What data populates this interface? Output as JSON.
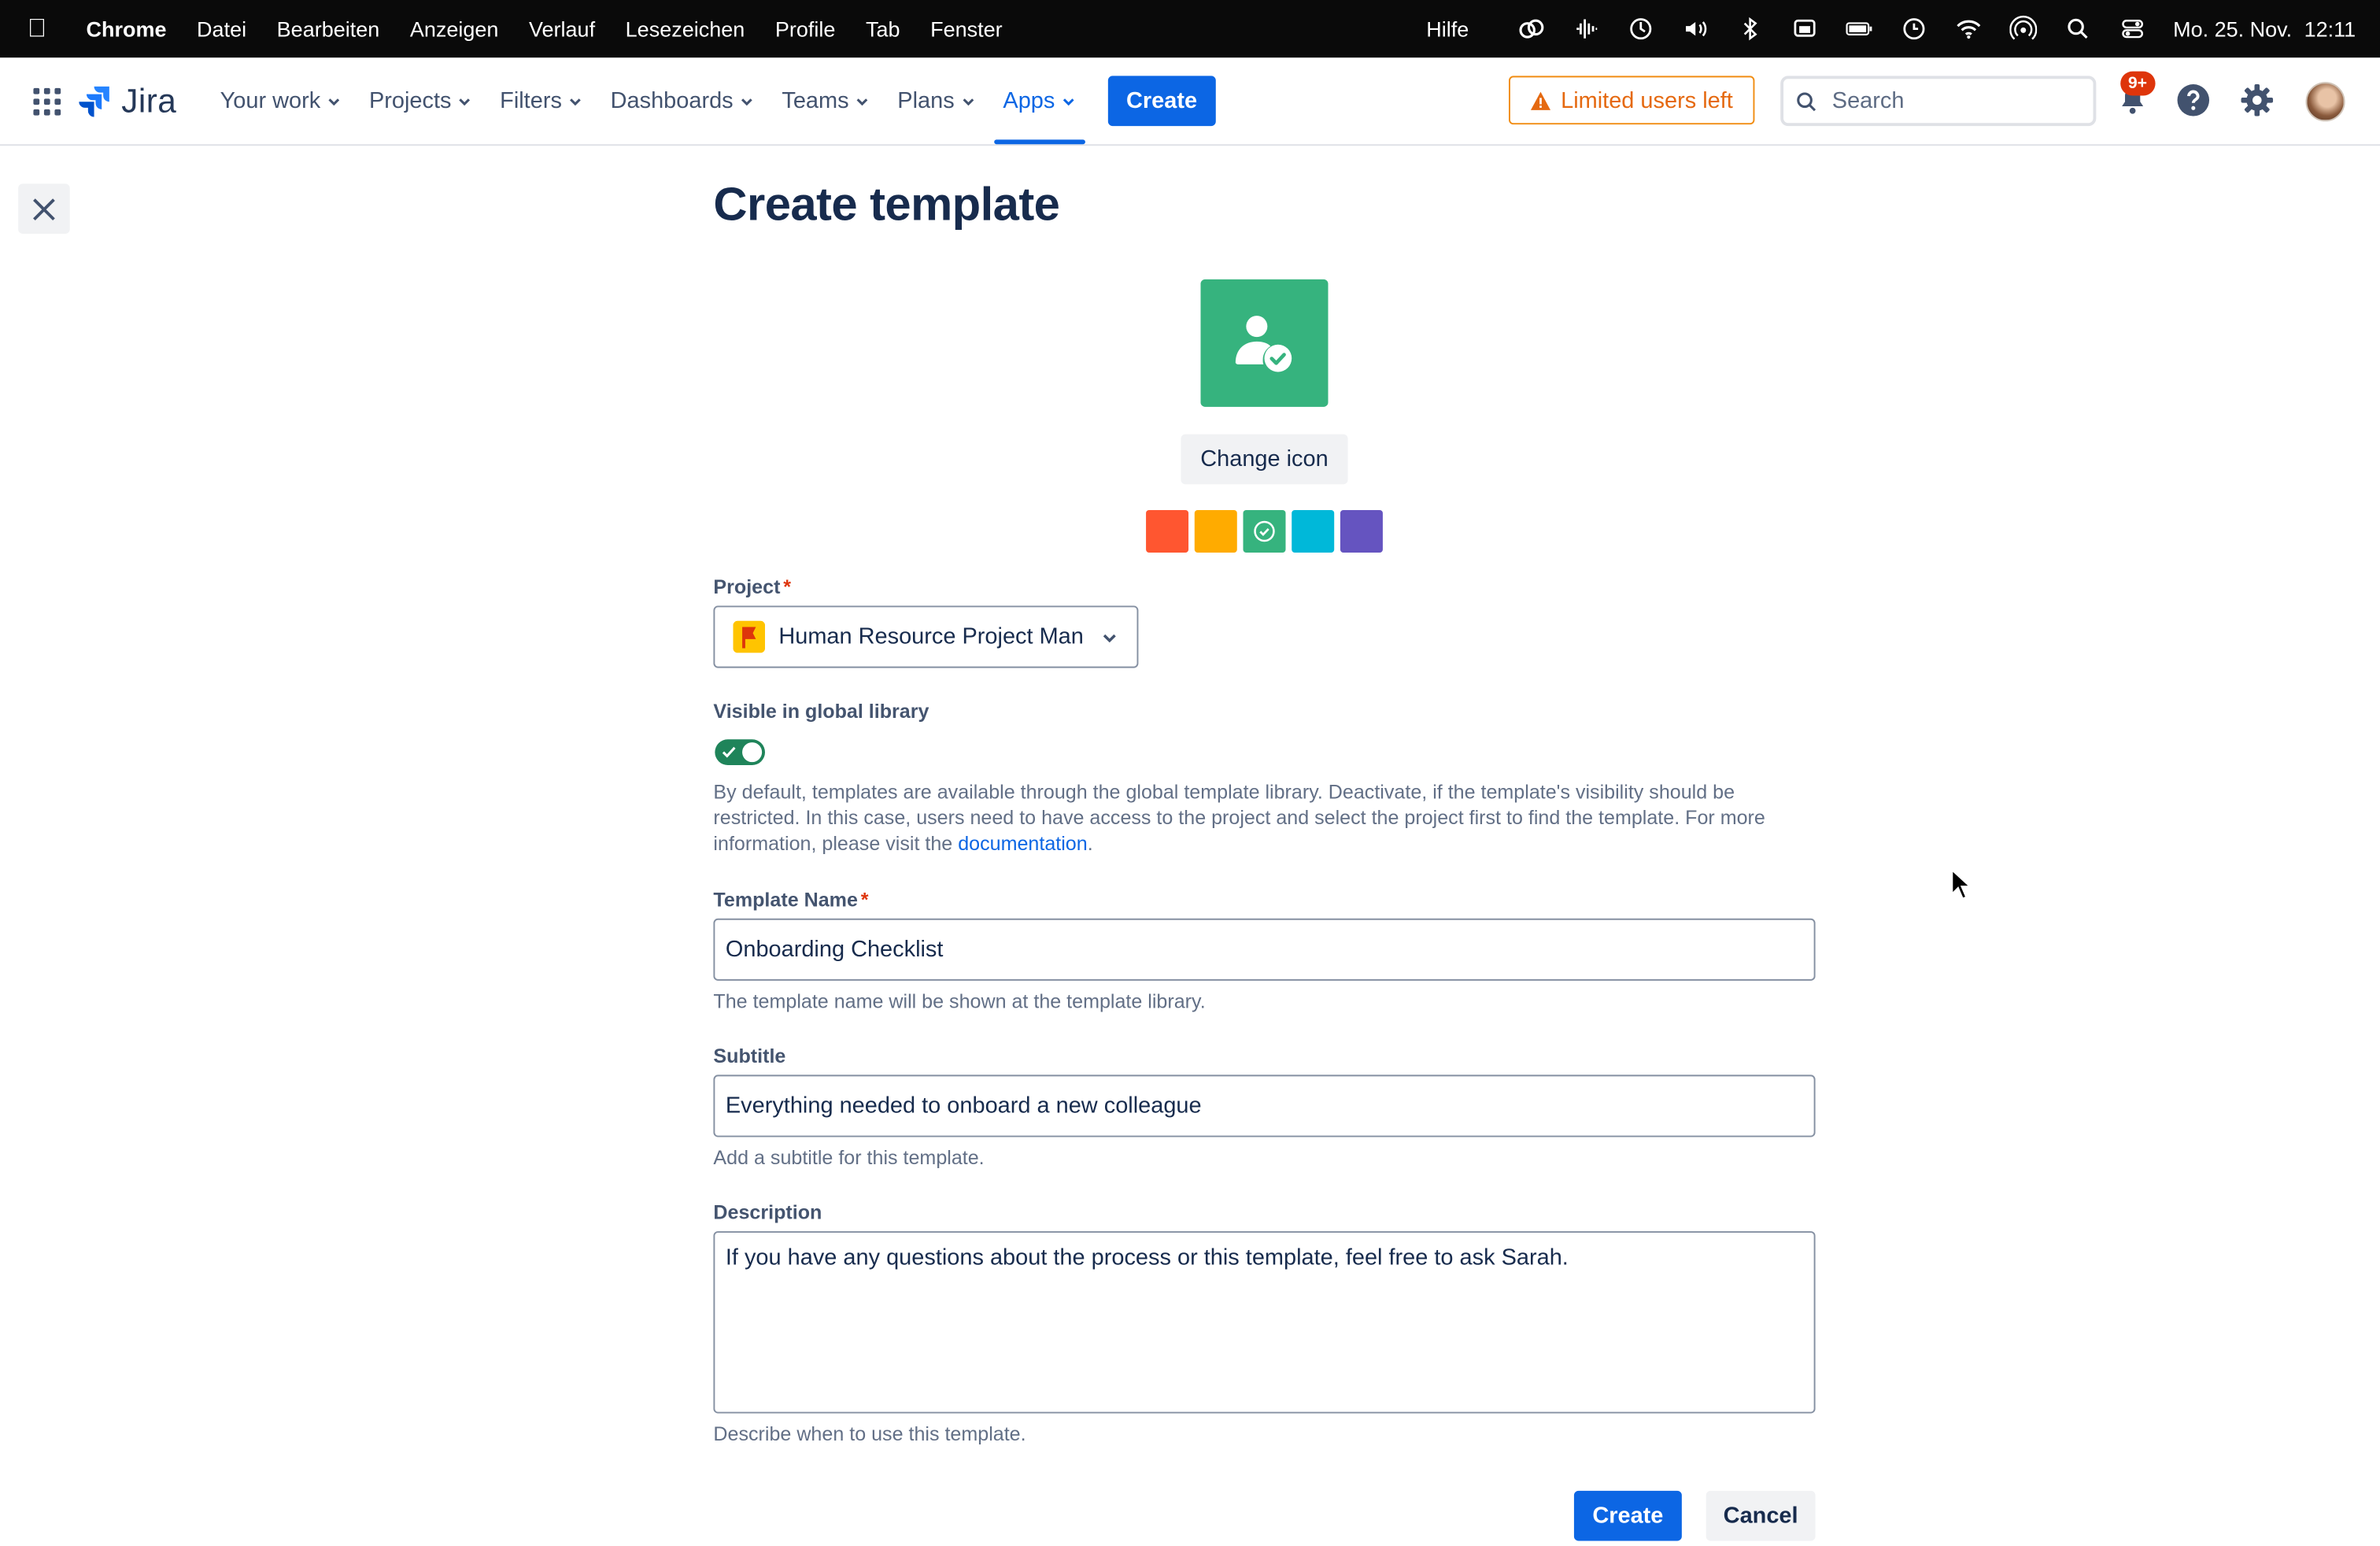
{
  "menubar": {
    "app_name": "Chrome",
    "menus": [
      "Datei",
      "Bearbeiten",
      "Anzeigen",
      "Verlauf",
      "Lesezeichen",
      "Profile",
      "Tab",
      "Fenster"
    ],
    "help": "Hilfe",
    "date": "Mo. 25. Nov.",
    "time": "12:11"
  },
  "nav": {
    "logo_text": "Jira",
    "items": [
      {
        "label": "Your work"
      },
      {
        "label": "Projects"
      },
      {
        "label": "Filters"
      },
      {
        "label": "Dashboards"
      },
      {
        "label": "Teams"
      },
      {
        "label": "Plans"
      },
      {
        "label": "Apps"
      }
    ],
    "active_item": "Apps",
    "create_label": "Create",
    "limited_users_label": "Limited users left",
    "search_placeholder": "Search",
    "notification_badge": "9+"
  },
  "page": {
    "title": "Create template",
    "change_icon_label": "Change icon",
    "selected_color": "#36b37e",
    "icon_colors": [
      "#ff5630",
      "#ffab00",
      "#36b37e",
      "#00b8d9",
      "#6554c0"
    ],
    "project": {
      "label": "Project",
      "value": "Human Resource Project Management"
    },
    "visible_global": {
      "label": "Visible in global library",
      "enabled": true,
      "description": "By default, templates are available through the global template library. Deactivate, if the template's visibility should be restricted. In this case, users need to have access to the project and select the project first to find the template. For more information, please visit the",
      "link_text": "documentation",
      "suffix": "."
    },
    "template_name": {
      "label": "Template Name",
      "value": "Onboarding Checklist",
      "help": "The template name will be shown at the template library."
    },
    "subtitle": {
      "label": "Subtitle",
      "value": "Everything needed to onboard a new colleague",
      "help": "Add a subtitle for this template."
    },
    "description": {
      "label": "Description",
      "value": "If you have any questions about the process or this template, feel free to ask Sarah.",
      "help": "Describe when to use this template."
    },
    "required_marker": "*",
    "create_label": "Create",
    "cancel_label": "Cancel"
  }
}
